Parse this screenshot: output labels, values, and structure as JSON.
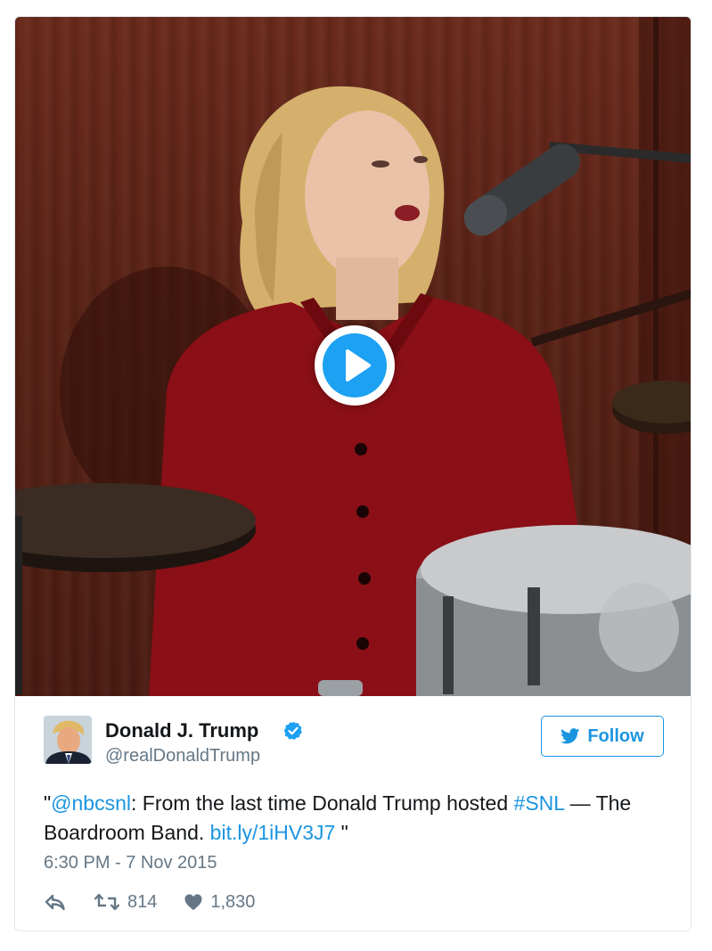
{
  "media": {
    "play_icon": "play-icon"
  },
  "user": {
    "name": "Donald J. Trump",
    "handle": "@realDonaldTrump",
    "verified_icon": "verified-badge-icon"
  },
  "follow_button": {
    "label": "Follow",
    "icon": "twitter-bird-icon"
  },
  "tweet": {
    "quote_open": "\"",
    "mention": "@nbcsnl",
    "text_part1": ": From the last time Donald Trump hosted ",
    "hashtag": "#SNL",
    "text_part2": " — The Boardroom Band. ",
    "link": "bit.ly/1iHV3J7",
    "quote_close": " \"",
    "timestamp": "6:30 PM - 7 Nov 2015"
  },
  "actions": {
    "reply_icon": "reply-icon",
    "retweet_icon": "retweet-icon",
    "retweet_count": "814",
    "like_icon": "heart-icon",
    "like_count": "1,830"
  },
  "colors": {
    "accent": "#1da1f2",
    "link": "#1b95e0",
    "muted": "#657786",
    "text": "#14171a"
  }
}
